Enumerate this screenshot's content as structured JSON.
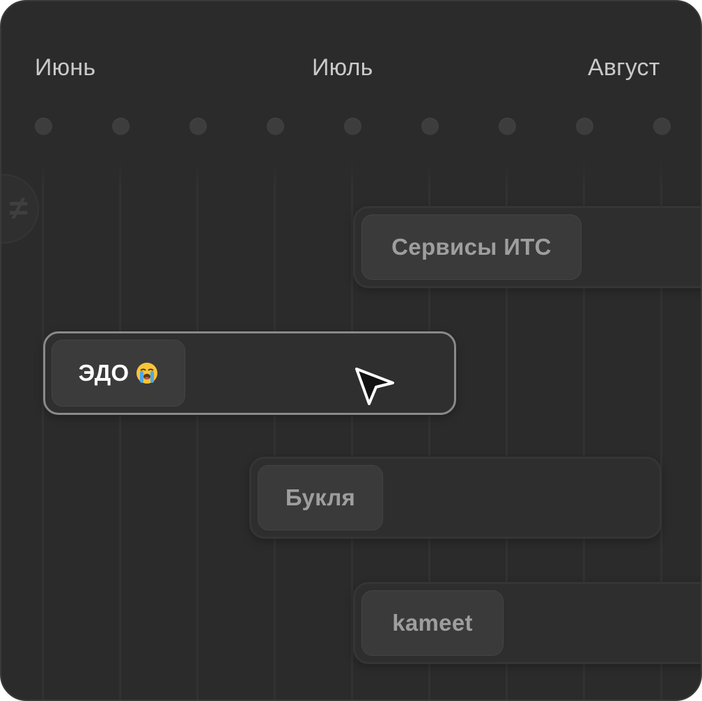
{
  "timeline": {
    "months": [
      "Июнь",
      "Июль",
      "Август"
    ]
  },
  "side_badge": {
    "glyph": "≠"
  },
  "tasks": [
    {
      "label": "Сервисы ИТС",
      "active": false
    },
    {
      "label": "ЭДО",
      "emoji": "loudly-crying-face-icon",
      "active": true
    },
    {
      "label": "Букля",
      "active": false
    },
    {
      "label": "kameet",
      "active": false
    }
  ],
  "colors": {
    "background": "#2b2b2b",
    "active_border": "#8a8a8a",
    "inactive_text": "#9e9e9e",
    "active_text": "#ffffff"
  }
}
